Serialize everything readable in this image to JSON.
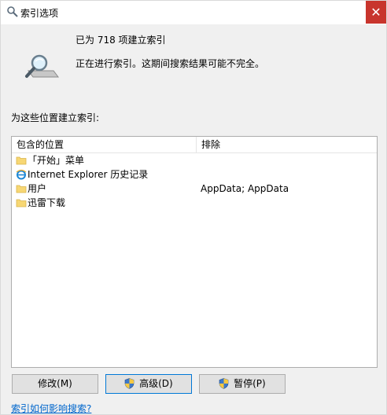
{
  "window": {
    "title": "索引选项",
    "close_glyph": "✕"
  },
  "status": {
    "count_text": "已为 718 项建立索引",
    "progress_text": "正在进行索引。这期间搜索结果可能不完全。"
  },
  "locations": {
    "section_label": "为这些位置建立索引:",
    "headers": {
      "included": "包含的位置",
      "excluded": "排除"
    },
    "rows": [
      {
        "name": "「开始」菜单",
        "exclude": "",
        "icon": "folder-icon"
      },
      {
        "name": "Internet Explorer 历史记录",
        "exclude": "",
        "icon": "ie-icon"
      },
      {
        "name": "用户",
        "exclude": "AppData; AppData",
        "icon": "folder-icon"
      },
      {
        "name": "迅雷下载",
        "exclude": "",
        "icon": "folder-icon"
      }
    ]
  },
  "buttons": {
    "modify": "修改(M)",
    "advanced": "高级(D)",
    "pause": "暂停(P)"
  },
  "help_link": "索引如何影响搜索?",
  "colors": {
    "close_bg": "#c8352d",
    "link": "#0066cc",
    "folder": "#f7d774",
    "focus_border": "#0078d7"
  }
}
